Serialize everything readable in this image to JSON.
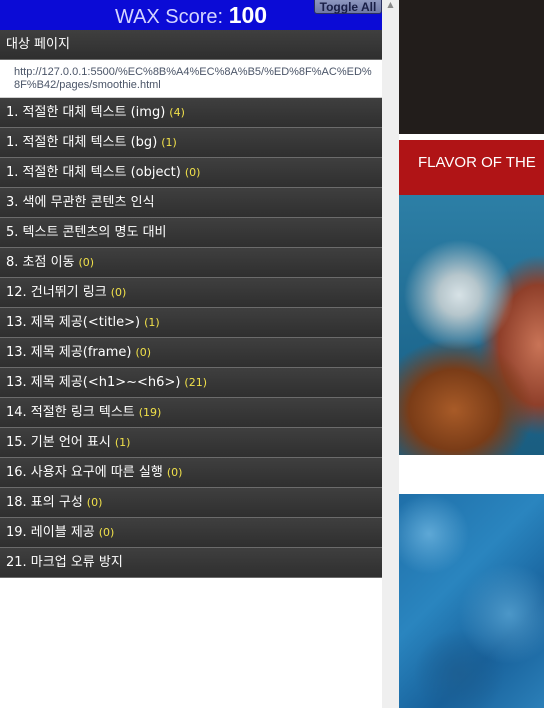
{
  "wax": {
    "score_label": "WAX Score:",
    "score_value": "100",
    "toggle_label": "Toggle All",
    "target_label": "대상 페이지",
    "target_url": "http://127.0.0.1:5500/%EC%8B%A4%EC%8A%B5/%ED%8F%AC%ED%8F%B42/pages/smoothie.html",
    "items": [
      {
        "label": "1. 적절한 대체 텍스트 (img)",
        "count": "(4)"
      },
      {
        "label": "1. 적절한 대체 텍스트 (bg)",
        "count": "(1)"
      },
      {
        "label": "1. 적절한 대체 텍스트 (object)",
        "count": "(0)"
      },
      {
        "label": "3. 색에 무관한 콘텐츠 인식",
        "count": ""
      },
      {
        "label": "5. 텍스트 콘텐츠의 명도 대비",
        "count": ""
      },
      {
        "label": "8. 초점 이동",
        "count": "(0)"
      },
      {
        "label": "12. 건너뛰기 링크",
        "count": "(0)"
      },
      {
        "label": "13. 제목 제공(<title>)",
        "count": "(1)"
      },
      {
        "label": "13. 제목 제공(frame)",
        "count": "(0)"
      },
      {
        "label": "13. 제목 제공(<h1>~<h6>)",
        "count": "(21)"
      },
      {
        "label": "14. 적절한 링크 텍스트",
        "count": "(19)"
      },
      {
        "label": "15. 기본 언어 표시",
        "count": "(1)"
      },
      {
        "label": "16. 사용자 요구에 따른 실행",
        "count": "(0)"
      },
      {
        "label": "18. 표의 구성",
        "count": "(0)"
      },
      {
        "label": "19. 레이블 제공",
        "count": "(0)"
      },
      {
        "label": "21. 마크업 오류 방지",
        "count": ""
      }
    ]
  },
  "page": {
    "banner_text": "FLAVOR OF THE"
  },
  "colors": {
    "header_bg": "#0b0bd6",
    "row_bg": "#3a3a3a",
    "count_color": "#f0e04a",
    "banner_red": "#b01416"
  }
}
